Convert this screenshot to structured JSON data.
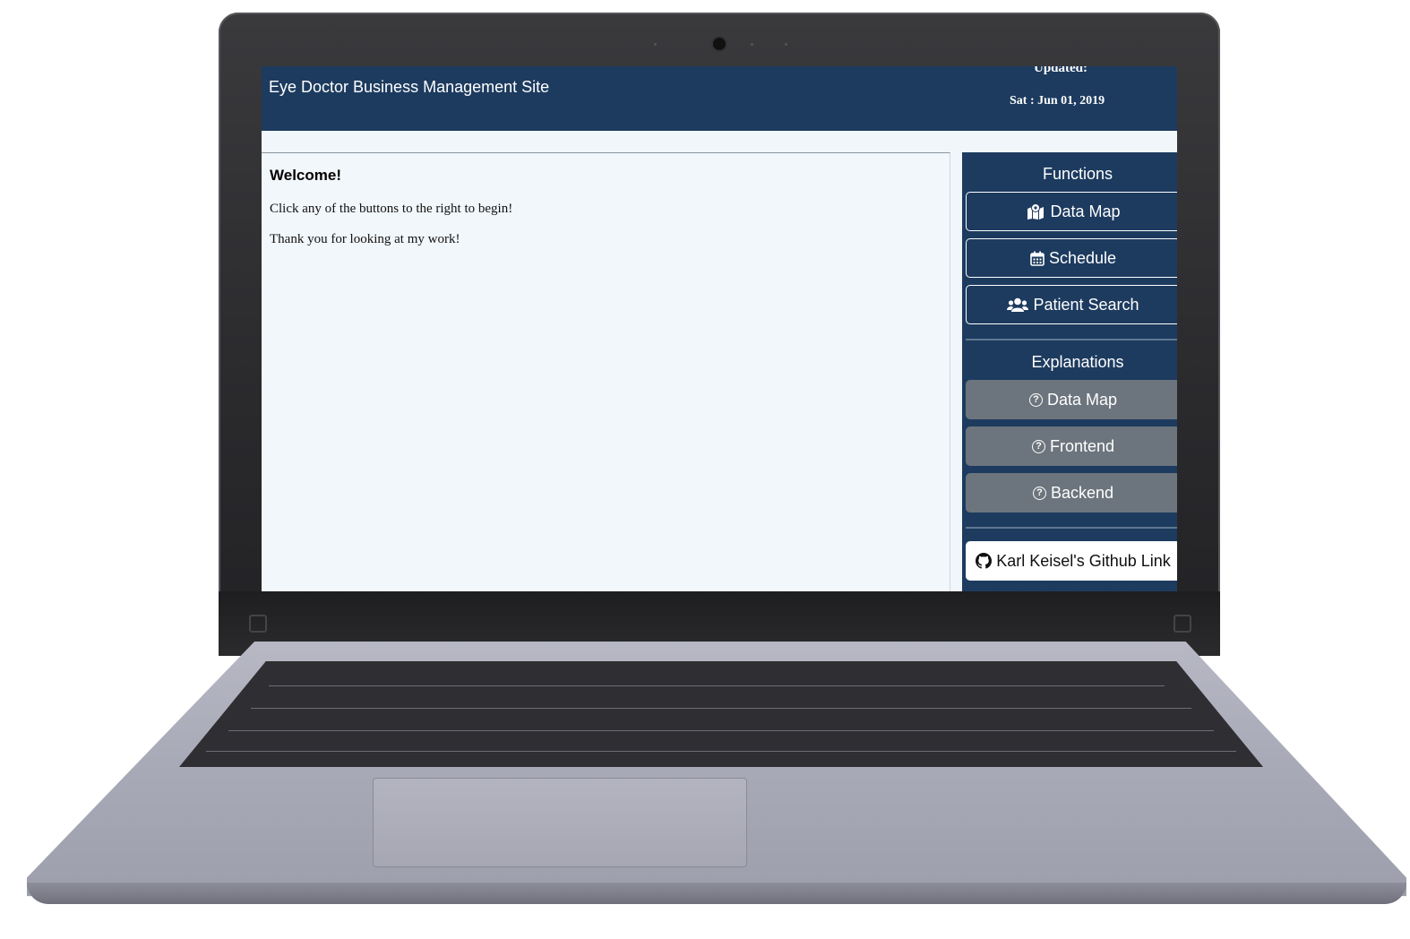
{
  "header": {
    "title": "Eye Doctor Business Management Site",
    "updated_label": "Updated:",
    "updated_date": "Sat : Jun 01, 2019"
  },
  "main": {
    "heading": "Welcome!",
    "line1": "Click any of the buttons to the right to begin!",
    "line2": "Thank you for looking at my work!"
  },
  "sidebar": {
    "functions_title": "Functions",
    "functions": [
      {
        "label": "Data Map",
        "icon": "map-marked-icon"
      },
      {
        "label": "Schedule",
        "icon": "calendar-icon"
      },
      {
        "label": "Patient Search",
        "icon": "users-icon"
      }
    ],
    "explanations_title": "Explanations",
    "explanations": [
      {
        "label": "Data Map",
        "icon": "question-circle-icon"
      },
      {
        "label": "Frontend",
        "icon": "question-circle-icon"
      },
      {
        "label": "Backend",
        "icon": "question-circle-icon"
      }
    ],
    "github_label": "Karl Keisel's Github Link",
    "github_icon": "github-icon"
  },
  "colors": {
    "navy": "#1d3b5f",
    "gray_button": "#6c757d",
    "page_bg": "#f0f6fa"
  }
}
